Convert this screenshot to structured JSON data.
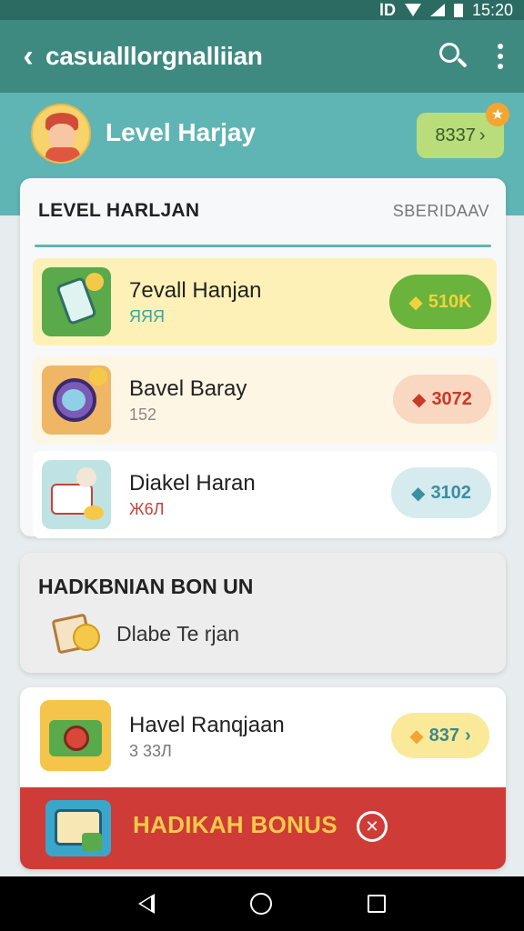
{
  "status_bar": {
    "time": "15:20",
    "left_icon": "lD"
  },
  "app_bar": {
    "title": "casualllorgnalliian",
    "back_icon": "chevron-left-icon",
    "search_icon": "search-icon",
    "more_icon": "more-vert-icon"
  },
  "profile": {
    "name": "Level Harjay",
    "coins": "8337",
    "coins_arrow": "›"
  },
  "card_levels": {
    "heading": "LEVEL HARLJAN",
    "heading_right": "SBERIDAAV",
    "rows": [
      {
        "name": "7evall Hanjan",
        "sub": "ЯЯЯ",
        "pill": "510K",
        "pill_icon": "◆"
      },
      {
        "name": "Bavel Baray",
        "sub": "152",
        "pill": "3072",
        "pill_icon": "◆"
      },
      {
        "name": "Diakel Haran",
        "sub": "Ж6Л",
        "pill": "3102",
        "pill_icon": "◆"
      }
    ]
  },
  "card_bonus": {
    "heading": "HADKBNIAN BON UN",
    "label": "Dlabe Te rjan"
  },
  "card_reward": {
    "name": "Havel Ranqjaan",
    "sub": "3 33Л",
    "pill": "837",
    "pill_icon": "◆",
    "pill_arrow": "›"
  },
  "bonus_button": {
    "label": "HADIKAH BONUS",
    "close": "✕"
  },
  "colors": {
    "primary": "#3f8a80",
    "accent_red": "#cf3b36",
    "accent_yellow": "#f4c94a"
  }
}
